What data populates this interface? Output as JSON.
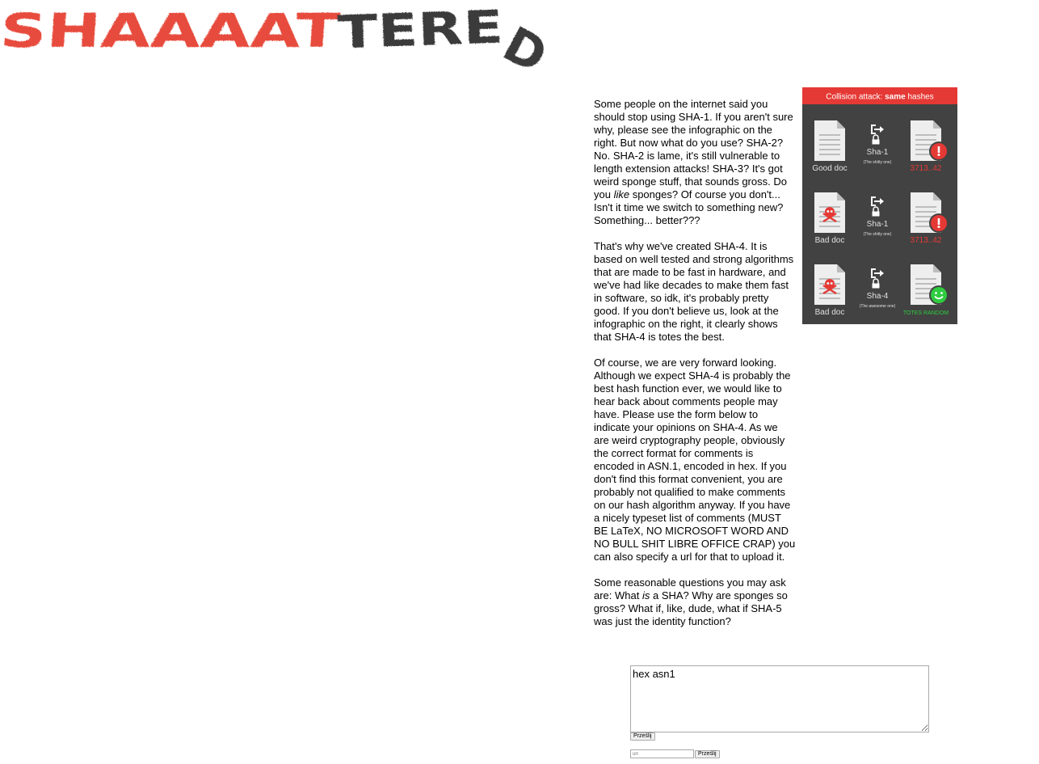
{
  "logo": {
    "text": "SHAAAATTERED"
  },
  "content": {
    "p1": {
      "before_like": "Some people on the internet said you should stop using SHA-1. If you aren't sure why, please see the infographic on the right. But now what do you use? SHA-2? No. SHA-2 is lame, it's still vulnerable to length extension attacks! SHA-3? It's got weird sponge stuff, that sounds gross. Do you ",
      "like": "like",
      "after_like": " sponges? Of course you don't... Isn't it time we switch to something new? Something... better???"
    },
    "p2": "That's why we've created SHA-4. It is based on well tested and strong algorithms that are made to be fast in hardware, and we've had like decades to make them fast in software, so idk, it's probably pretty good. If you don't believe us, look at the infographic on the right, it clearly shows that SHA-4 is totes the best.",
    "p3": "Of course, we are very forward looking. Although we expect SHA-4 is probably the best hash function ever, we would like to hear back about comments people may have. Please use the form below to indicate your opinions on SHA-4. As we are weird cryptography people, obviously the correct format for comments is encoded in ASN.1, encoded in hex. If you don't find this format convenient, you are probably not qualified to make comments on our hash algorithm anyway. If you have a nicely typeset list of comments (MUST BE LaTeX, NO MICROSOFT WORD AND NO BULL SHIT LIBRE OFFICE CRAP) you can also specify a url for that to upload it.",
    "p4": {
      "before_is": "Some reasonable questions you may ask are: What ",
      "is": "is",
      "after_is": " a SHA? Why are sponges so gross? What if, like, dude, what if SHA-5 was just the identity function?"
    }
  },
  "infographic": {
    "title_pre": "Collision attack: ",
    "title_bold": "same",
    "title_post": " hashes",
    "rows": [
      {
        "doc_label": "Good doc",
        "algo": "Sha-1",
        "algo_sub": "(The shitty one)",
        "result": "3713..42",
        "result_color": "#e53935",
        "badge": "alert",
        "doc_icon": "document-icon"
      },
      {
        "doc_label": "Bad doc",
        "algo": "Sha-1",
        "algo_sub": "(The shitty one)",
        "result": "3713..42",
        "result_color": "#e53935",
        "badge": "alert",
        "doc_icon": "skull-document-icon"
      },
      {
        "doc_label": "Bad doc",
        "algo": "Sha-4",
        "algo_sub": "(The awesome one)",
        "result": "TOTES RANDOM",
        "result_color": "#2ecc40",
        "badge": "smile",
        "doc_icon": "skull-document-icon"
      }
    ],
    "colors": {
      "background": "#424242",
      "header": "#e53935",
      "alert": "#e53935",
      "ok": "#2ecc40"
    }
  },
  "form": {
    "comment_value": "hex asn1",
    "submit_label": "Prześlij",
    "url_placeholder": "url",
    "url_submit_label": "Prześlij"
  }
}
